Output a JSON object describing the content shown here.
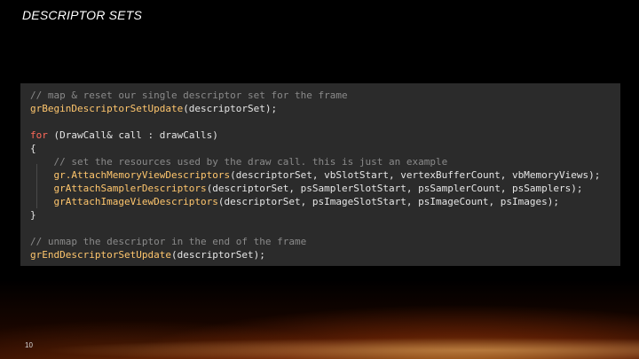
{
  "slide": {
    "title": "DESCRIPTOR SETS",
    "page_number": "10"
  },
  "code": {
    "lines": [
      [
        {
          "t": "// map & reset our single descriptor set for the frame",
          "k": "comment"
        }
      ],
      [
        {
          "t": "grBeginDescriptorSetUpdate",
          "k": "fn"
        },
        {
          "t": "(descriptorSet);",
          "k": "plain"
        }
      ],
      [],
      [
        {
          "t": "for",
          "k": "kw"
        },
        {
          "t": " (DrawCall& call : drawCalls)",
          "k": "plain"
        }
      ],
      [
        {
          "t": "{",
          "k": "plain"
        }
      ],
      [
        {
          "t": "    // set the resources used by the draw call. this is just an example",
          "k": "comment"
        }
      ],
      [
        {
          "t": "    gr.AttachMemoryViewDescriptors",
          "k": "fn"
        },
        {
          "t": "(descriptorSet, vbSlotStart, vertexBufferCount, vbMemoryViews);",
          "k": "plain"
        }
      ],
      [
        {
          "t": "    grAttachSamplerDescriptors",
          "k": "fn"
        },
        {
          "t": "(descriptorSet, psSamplerSlotStart, psSamplerCount, psSamplers);",
          "k": "plain"
        }
      ],
      [
        {
          "t": "    grAttachImageViewDescriptors",
          "k": "fn"
        },
        {
          "t": "(descriptorSet, psImageSlotStart, psImageCount, psImages);",
          "k": "plain"
        }
      ],
      [
        {
          "t": "}",
          "k": "plain"
        }
      ],
      [],
      [
        {
          "t": "// unmap the descriptor in the end of the frame",
          "k": "comment"
        }
      ],
      [
        {
          "t": "grEndDescriptorSetUpdate",
          "k": "fn"
        },
        {
          "t": "(descriptorSet);",
          "k": "plain"
        }
      ]
    ]
  },
  "colors": {
    "background": "#000000",
    "code_background": "#2b2b2b",
    "comment": "#8a8a8a",
    "function": "#ffc66d",
    "keyword": "#ff6a5a",
    "text": "#e6e6e6"
  }
}
